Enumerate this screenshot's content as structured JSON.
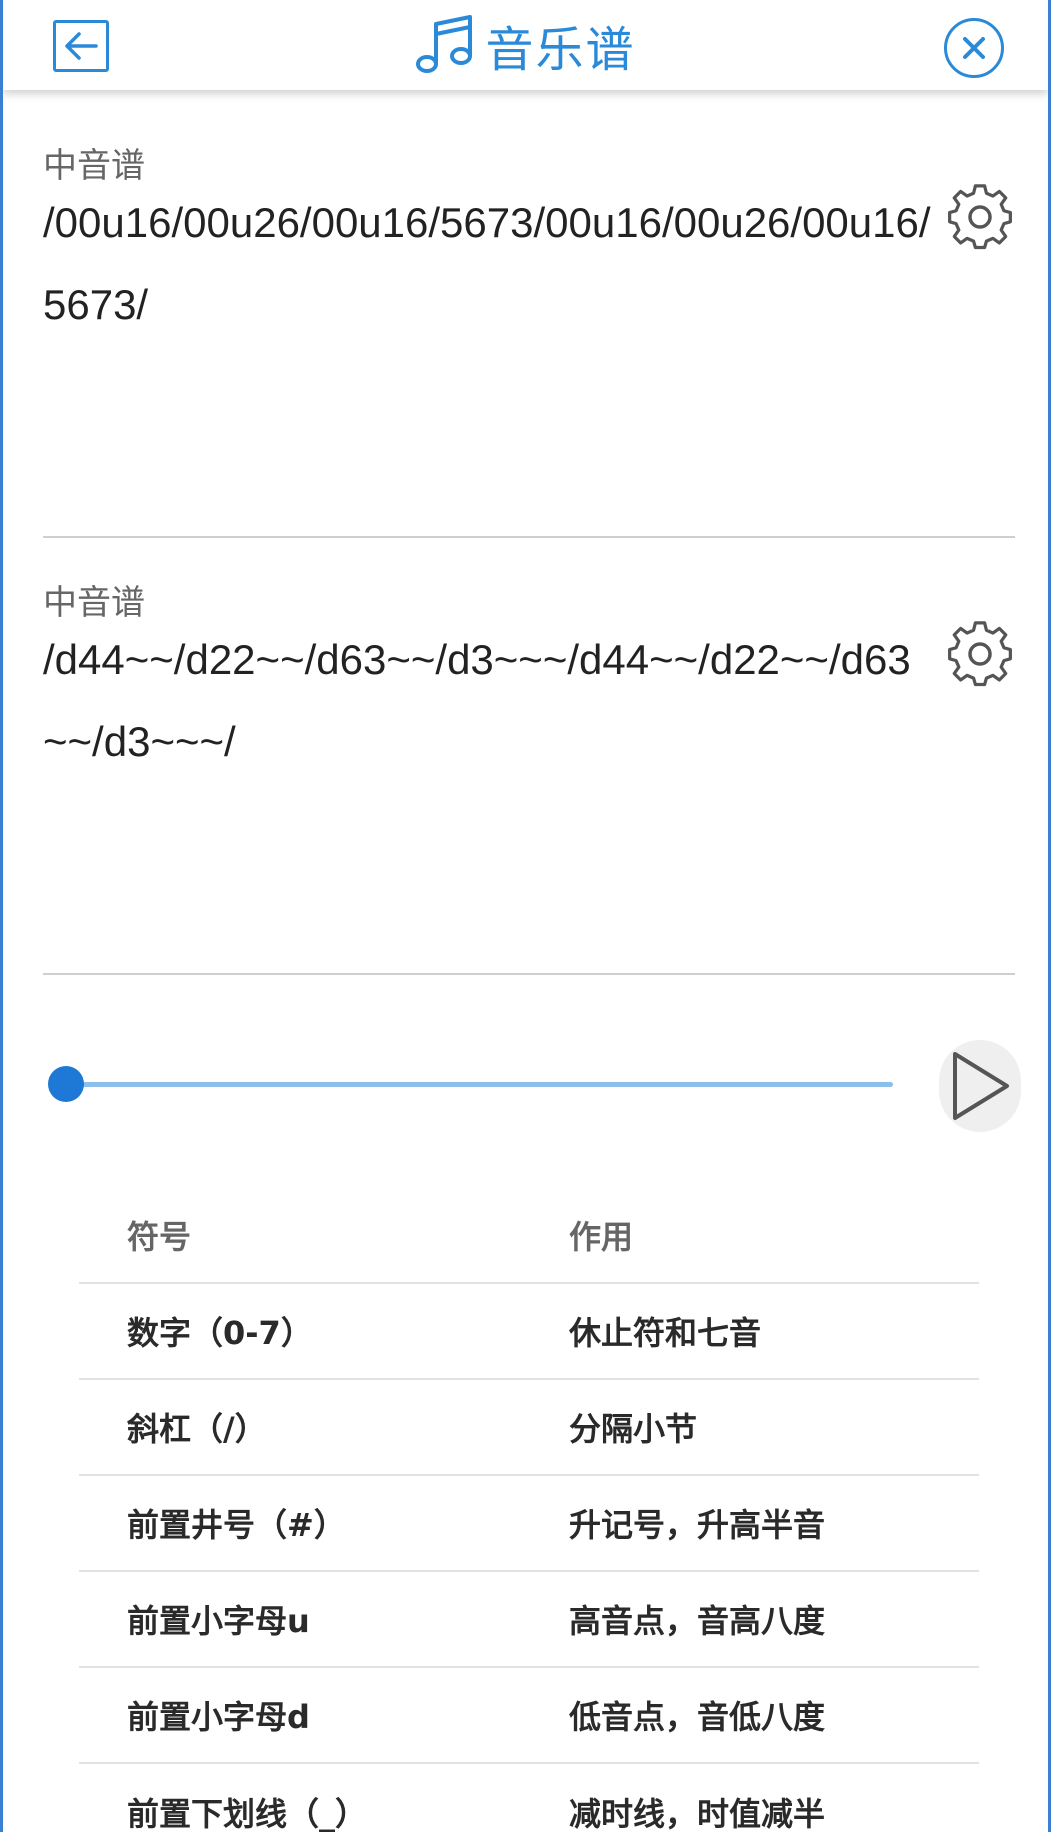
{
  "header": {
    "title": "音乐谱",
    "back_icon": "back-arrow-icon",
    "close_icon": "close-icon",
    "music_icon": "music-note-icon",
    "accent_color": "#2b8ad8"
  },
  "scores": [
    {
      "label": "中音谱",
      "text": "/00u16/00u26/00u16/5673/00u16/00u26/00u16/5673/",
      "settings_icon": "gear-icon"
    },
    {
      "label": "中音谱",
      "text": "/d44~~/d22~~/d63~~/d3~~~/d44~~/d22~~/d63~~/d3~~~/",
      "settings_icon": "gear-icon"
    }
  ],
  "player": {
    "progress_fraction": 0.0,
    "play_icon": "play-icon",
    "track_color": "#8cc0ea",
    "thumb_color": "#1e78d6"
  },
  "legend_table": {
    "headers": [
      "符号",
      "作用"
    ],
    "rows": [
      [
        "数字（0-7）",
        "休止符和七音"
      ],
      [
        "斜杠（/）",
        "分隔小节"
      ],
      [
        "前置井号（#）",
        "升记号，升高半音"
      ],
      [
        "前置小字母u",
        "高音点，音高八度"
      ],
      [
        "前置小字母d",
        "低音点，音低八度"
      ],
      [
        "前置下划线（_）",
        "减时线，时值减半"
      ]
    ]
  }
}
